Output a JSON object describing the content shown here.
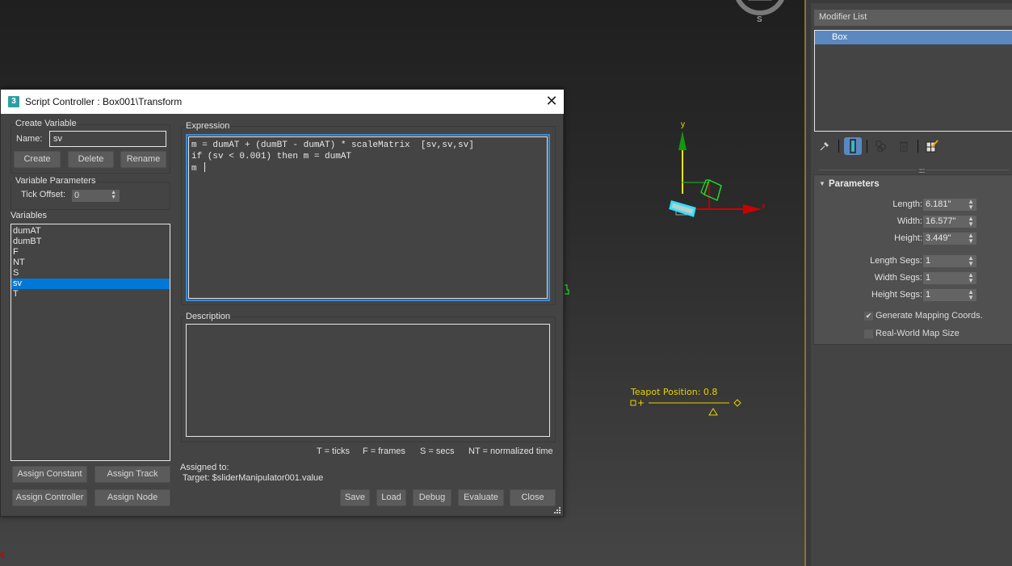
{
  "viewport": {
    "viewcube_label": "S",
    "gizmo_axes": {
      "x": "x",
      "y": "y"
    },
    "manipulator": {
      "label": "Teapot Position: 0.8",
      "slider_value": 0.8,
      "color": "#e8d200"
    },
    "colors": {
      "x_axis": "#d40000",
      "y_axis": "#e6e600",
      "y_arrow": "#119911",
      "selection": "#33e0ff",
      "helper": "#22dd22"
    }
  },
  "command_panel": {
    "modifier_list_label": "Modifier List",
    "stack_items": [
      {
        "label": "Box",
        "selected": true
      }
    ],
    "stack_tools": [
      {
        "name": "pin-stack-icon"
      },
      {
        "name": "show-end-result-icon",
        "active": true
      },
      {
        "name": "make-unique-icon"
      },
      {
        "name": "remove-modifier-icon"
      },
      {
        "name": "configure-modifier-sets-icon"
      }
    ],
    "rollout": {
      "title": "Parameters",
      "params": [
        {
          "label": "Length:",
          "value": "6.181\""
        },
        {
          "label": "Width:",
          "value": "16.577\""
        },
        {
          "label": "Height:",
          "value": "3.449\""
        },
        {
          "label": "Length Segs:",
          "value": "1"
        },
        {
          "label": "Width Segs:",
          "value": "1"
        },
        {
          "label": "Height Segs:",
          "value": "1"
        }
      ],
      "checkboxes": [
        {
          "label": "Generate Mapping Coords.",
          "checked": true
        },
        {
          "label": "Real-World Map Size",
          "checked": false
        }
      ]
    }
  },
  "dialog": {
    "app_icon": "3",
    "title": "Script Controller : Box001\\Transform",
    "create_variable": {
      "group_label": "Create Variable",
      "name_label": "Name:",
      "name_value": "sv",
      "create": "Create",
      "delete": "Delete",
      "rename": "Rename"
    },
    "variable_parameters": {
      "group_label": "Variable Parameters",
      "tick_offset_label": "Tick Offset:",
      "tick_offset_value": "0"
    },
    "variables": {
      "label": "Variables",
      "items": [
        "dumAT",
        "dumBT",
        "F",
        "NT",
        "S",
        "sv",
        "T"
      ],
      "selected": "sv"
    },
    "assign_buttons": {
      "constant": "Assign Constant",
      "track": "Assign Track",
      "controller": "Assign Controller",
      "node": "Assign Node"
    },
    "expression": {
      "label": "Expression",
      "lines": [
        "m = dumAT + (dumBT - dumAT) * scaleMatrix  [sv,sv,sv]",
        "if (sv < 0.001) then m = dumAT",
        "m "
      ]
    },
    "description": {
      "label": "Description",
      "value": ""
    },
    "legend": {
      "t": "T = ticks",
      "f": "F = frames",
      "s": "S = secs",
      "nt": "NT = normalized time"
    },
    "assigned": {
      "label": "Assigned to:",
      "target": "Target: $sliderManipulator001.value"
    },
    "buttons": {
      "save": "Save",
      "load": "Load",
      "debug": "Debug",
      "evaluate": "Evaluate",
      "close": "Close"
    }
  }
}
